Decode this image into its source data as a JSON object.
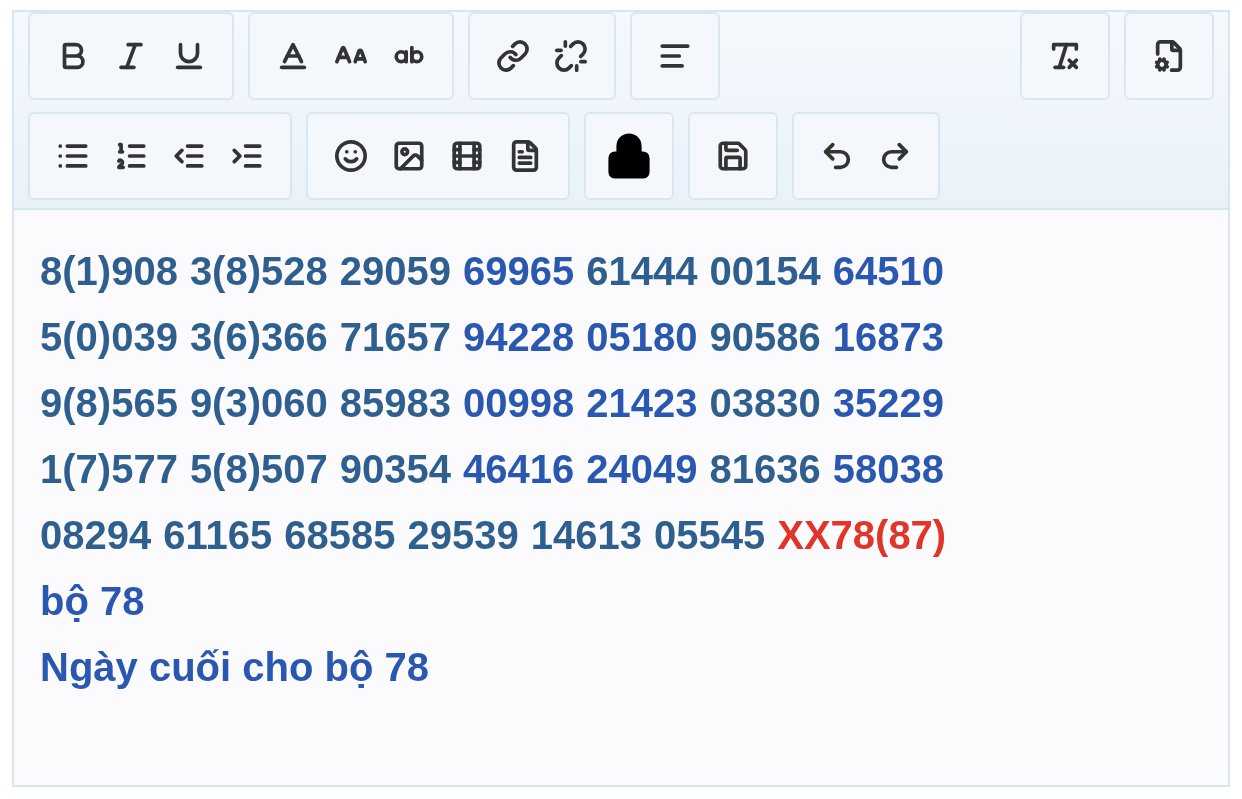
{
  "toolbar": {
    "rows": [
      {
        "groups": [
          {
            "buttons": [
              {
                "kind": "bold"
              },
              {
                "kind": "italic"
              },
              {
                "kind": "underline"
              }
            ]
          },
          {
            "buttons": [
              {
                "kind": "text-color"
              },
              {
                "kind": "font-size"
              },
              {
                "kind": "text-case"
              }
            ]
          },
          {
            "buttons": [
              {
                "kind": "link"
              },
              {
                "kind": "unlink"
              }
            ]
          },
          {
            "buttons": [
              {
                "kind": "align-left"
              }
            ]
          },
          {
            "kind": "spacer"
          },
          {
            "buttons": [
              {
                "kind": "clear-format"
              }
            ]
          },
          {
            "buttons": [
              {
                "kind": "source"
              }
            ]
          }
        ]
      },
      {
        "groups": [
          {
            "buttons": [
              {
                "kind": "bullet-list"
              },
              {
                "kind": "number-list"
              },
              {
                "kind": "outdent"
              },
              {
                "kind": "indent"
              }
            ]
          },
          {
            "buttons": [
              {
                "kind": "emoji"
              },
              {
                "kind": "image"
              },
              {
                "kind": "media"
              },
              {
                "kind": "template"
              }
            ]
          },
          {
            "buttons": [
              {
                "kind": "lock"
              }
            ]
          },
          {
            "buttons": [
              {
                "kind": "save"
              }
            ]
          },
          {
            "buttons": [
              {
                "kind": "undo"
              },
              {
                "kind": "redo"
              }
            ]
          }
        ]
      }
    ]
  },
  "content": {
    "lines": [
      {
        "words": [
          {
            "text": "8(1)908",
            "color": "#2f5f8f"
          },
          {
            "text": "3(8)528",
            "color": "#2f5f8f"
          },
          {
            "text": "29059",
            "color": "#2f5f8f"
          },
          {
            "text": "69965",
            "color": "#2a58b0"
          },
          {
            "text": "61444",
            "color": "#2f5f8f"
          },
          {
            "text": "00154",
            "color": "#2f5f8f"
          },
          {
            "text": "64510",
            "color": "#2a58b0"
          }
        ]
      },
      {
        "words": [
          {
            "text": "5(0)039",
            "color": "#2f5f8f"
          },
          {
            "text": "3(6)366",
            "color": "#2f5f8f"
          },
          {
            "text": "71657",
            "color": "#2f5f8f"
          },
          {
            "text": "94228",
            "color": "#2a58b0"
          },
          {
            "text": "05180",
            "color": "#2a58b0"
          },
          {
            "text": "90586",
            "color": "#2f5f8f"
          },
          {
            "text": "16873",
            "color": "#2a58b0"
          }
        ]
      },
      {
        "words": [
          {
            "text": "9(8)565",
            "color": "#2f5f8f"
          },
          {
            "text": "9(3)060",
            "color": "#2f5f8f"
          },
          {
            "text": "85983",
            "color": "#2f5f8f"
          },
          {
            "text": "00998",
            "color": "#2a58b0"
          },
          {
            "text": "21423",
            "color": "#2a58b0"
          },
          {
            "text": "03830",
            "color": "#2f5f8f"
          },
          {
            "text": "35229",
            "color": "#2a58b0"
          }
        ]
      },
      {
        "words": [
          {
            "text": "1(7)577",
            "color": "#2f5f8f"
          },
          {
            "text": "5(8)507",
            "color": "#2f5f8f"
          },
          {
            "text": "90354",
            "color": "#2f5f8f"
          },
          {
            "text": "46416",
            "color": "#2a58b0"
          },
          {
            "text": "24049",
            "color": "#2a58b0"
          },
          {
            "text": "81636",
            "color": "#2f5f8f"
          },
          {
            "text": "58038",
            "color": "#2a58b0"
          }
        ]
      },
      {
        "words": [
          {
            "text": "08294",
            "color": "#2f5f8f"
          },
          {
            "text": "61165",
            "color": "#2f5f8f"
          },
          {
            "text": "68585",
            "color": "#2f5f8f"
          },
          {
            "text": "29539",
            "color": "#2f5f8f"
          },
          {
            "text": "14613",
            "color": "#2f5f8f"
          },
          {
            "text": "05545",
            "color": "#2f5f8f"
          },
          {
            "text": "XX78(87)",
            "color": "#e2352a"
          }
        ]
      },
      {
        "words": [
          {
            "text": "bộ 78",
            "color": "#2a58b0"
          }
        ]
      },
      {
        "words": [
          {
            "text": "Ngày cuối cho bộ 78",
            "color": "#2a58b0"
          }
        ]
      }
    ]
  }
}
